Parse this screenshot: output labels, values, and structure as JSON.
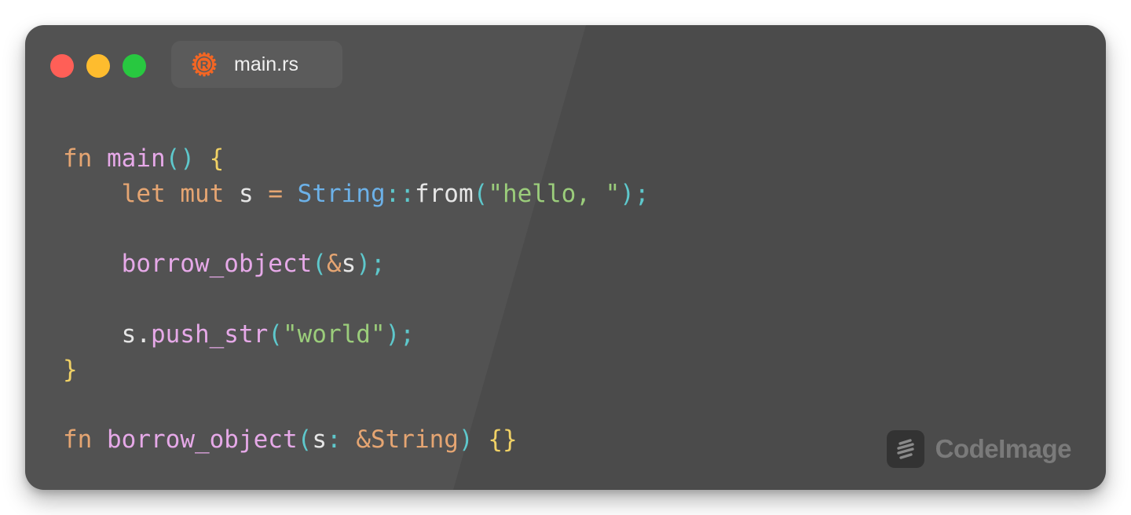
{
  "window": {
    "tab": {
      "label": "main.rs",
      "icon": "rust-icon",
      "icon_color": "#f46623"
    },
    "traffic_lights": {
      "close_color": "#ff5f57",
      "minimize_color": "#febc2e",
      "maximize_color": "#28c840"
    },
    "background_color": "#4b4b4b"
  },
  "code": {
    "language": "rust",
    "lines": [
      [
        {
          "t": "fn",
          "c": "kw"
        },
        {
          "t": " ",
          "c": "plain"
        },
        {
          "t": "main",
          "c": "fn"
        },
        {
          "t": "()",
          "c": "punc"
        },
        {
          "t": " ",
          "c": "plain"
        },
        {
          "t": "{",
          "c": "brace"
        }
      ],
      [
        {
          "t": "    ",
          "c": "plain"
        },
        {
          "t": "let",
          "c": "kw"
        },
        {
          "t": " ",
          "c": "plain"
        },
        {
          "t": "mut",
          "c": "kw"
        },
        {
          "t": " s ",
          "c": "plain"
        },
        {
          "t": "=",
          "c": "op"
        },
        {
          "t": " ",
          "c": "plain"
        },
        {
          "t": "String",
          "c": "type"
        },
        {
          "t": "::",
          "c": "punc"
        },
        {
          "t": "from",
          "c": "plain"
        },
        {
          "t": "(",
          "c": "punc"
        },
        {
          "t": "\"hello, \"",
          "c": "str"
        },
        {
          "t": ");",
          "c": "punc"
        }
      ],
      [],
      [
        {
          "t": "    ",
          "c": "plain"
        },
        {
          "t": "borrow_object",
          "c": "fn"
        },
        {
          "t": "(",
          "c": "punc"
        },
        {
          "t": "&",
          "c": "op"
        },
        {
          "t": "s",
          "c": "plain"
        },
        {
          "t": ");",
          "c": "punc"
        }
      ],
      [],
      [
        {
          "t": "    s.",
          "c": "plain"
        },
        {
          "t": "push_str",
          "c": "fn"
        },
        {
          "t": "(",
          "c": "punc"
        },
        {
          "t": "\"world\"",
          "c": "str"
        },
        {
          "t": ");",
          "c": "punc"
        }
      ],
      [
        {
          "t": "}",
          "c": "brace"
        }
      ],
      [],
      [
        {
          "t": "fn",
          "c": "kw"
        },
        {
          "t": " ",
          "c": "plain"
        },
        {
          "t": "borrow_object",
          "c": "fn"
        },
        {
          "t": "(",
          "c": "punc"
        },
        {
          "t": "s",
          "c": "plain"
        },
        {
          "t": ": ",
          "c": "punc"
        },
        {
          "t": "&String",
          "c": "kw"
        },
        {
          "t": ")",
          "c": "punc"
        },
        {
          "t": " ",
          "c": "plain"
        },
        {
          "t": "{}",
          "c": "brace"
        }
      ]
    ],
    "token_colors": {
      "kw": "#e5a572",
      "fn": "#e6a9e8",
      "punc": "#5ec8cc",
      "brace": "#f0d165",
      "plain": "#e6e6e6",
      "op": "#e5a572",
      "type": "#6cb1e8",
      "str": "#9bcd7b"
    }
  },
  "watermark": {
    "label": "CodeImage",
    "icon": "codeimage-logo-icon"
  }
}
